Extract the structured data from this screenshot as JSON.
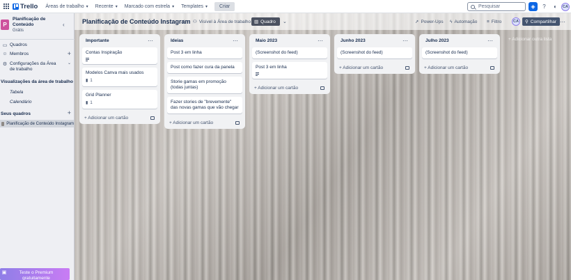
{
  "topbar": {
    "app_name": "Trello",
    "menus": [
      "Áreas de trabalho",
      "Recente",
      "Marcado com estrela",
      "Templates"
    ],
    "create_label": "Criar",
    "search_placeholder": "Pesquisar",
    "avatar_initials": "CA"
  },
  "sidebar": {
    "workspace_initial": "P",
    "workspace_name": "Planificação de Conteúdo",
    "workspace_plan": "Grátis",
    "items": [
      {
        "icon": "▭",
        "label": "Quadros"
      },
      {
        "icon": "☺",
        "label": "Membros"
      },
      {
        "icon": "⚙",
        "label": "Configurações da Área de trabalho"
      }
    ],
    "views_title": "Visualizações da área de trabalho",
    "views": [
      "Tabela",
      "Calendário"
    ],
    "boards_title": "Seus quadros",
    "boards": [
      "Planificação de Conteúdo Instagram"
    ],
    "premium_label": "Teste o Premium gratuitamente"
  },
  "board": {
    "title": "Planificação de Conteúdo Instagram",
    "visibility_label": "Visível à Área de trabalho",
    "view_label": "Quadro",
    "powerups_label": "Power-Ups",
    "automation_label": "Automação",
    "filter_label": "Filtro",
    "share_label": "Compartilhar",
    "add_card_label": "Adicionar um cartão",
    "add_list_label": "Adicionar outra lista",
    "lists": [
      {
        "title": "Importante",
        "cards": [
          {
            "text": "Contas Inspiração",
            "desc": true,
            "count": ""
          },
          {
            "text": "Modelos Canva mais usados",
            "desc": false,
            "count": "1"
          },
          {
            "text": "Grid Planner",
            "desc": false,
            "count": "1"
          }
        ]
      },
      {
        "title": "Ideias",
        "cards": [
          {
            "text": "Post 3 em linha",
            "desc": false,
            "count": ""
          },
          {
            "text": "Post como fazer cura da panela",
            "desc": false,
            "count": ""
          },
          {
            "text": "Storie gamas em promoção (todas juntas)",
            "desc": false,
            "count": ""
          },
          {
            "text": "Fazer stories de \"brevemente\" das novas gamas que vão chegar",
            "desc": false,
            "count": ""
          }
        ]
      },
      {
        "title": "Maio 2023",
        "cards": [
          {
            "text": "(Screenshot do feed)",
            "desc": false,
            "count": ""
          },
          {
            "text": "Post 3 em linha",
            "desc": true,
            "count": ""
          }
        ]
      },
      {
        "title": "Junho 2023",
        "cards": [
          {
            "text": "(Screenshot do feed)",
            "desc": false,
            "count": ""
          }
        ]
      },
      {
        "title": "Julho 2023",
        "cards": [
          {
            "text": "(Screenshot do feed)",
            "desc": false,
            "count": ""
          }
        ]
      }
    ]
  },
  "colors": {
    "accent": "#0c66e4",
    "workspace": "#cd519d",
    "share": "#44546f"
  }
}
